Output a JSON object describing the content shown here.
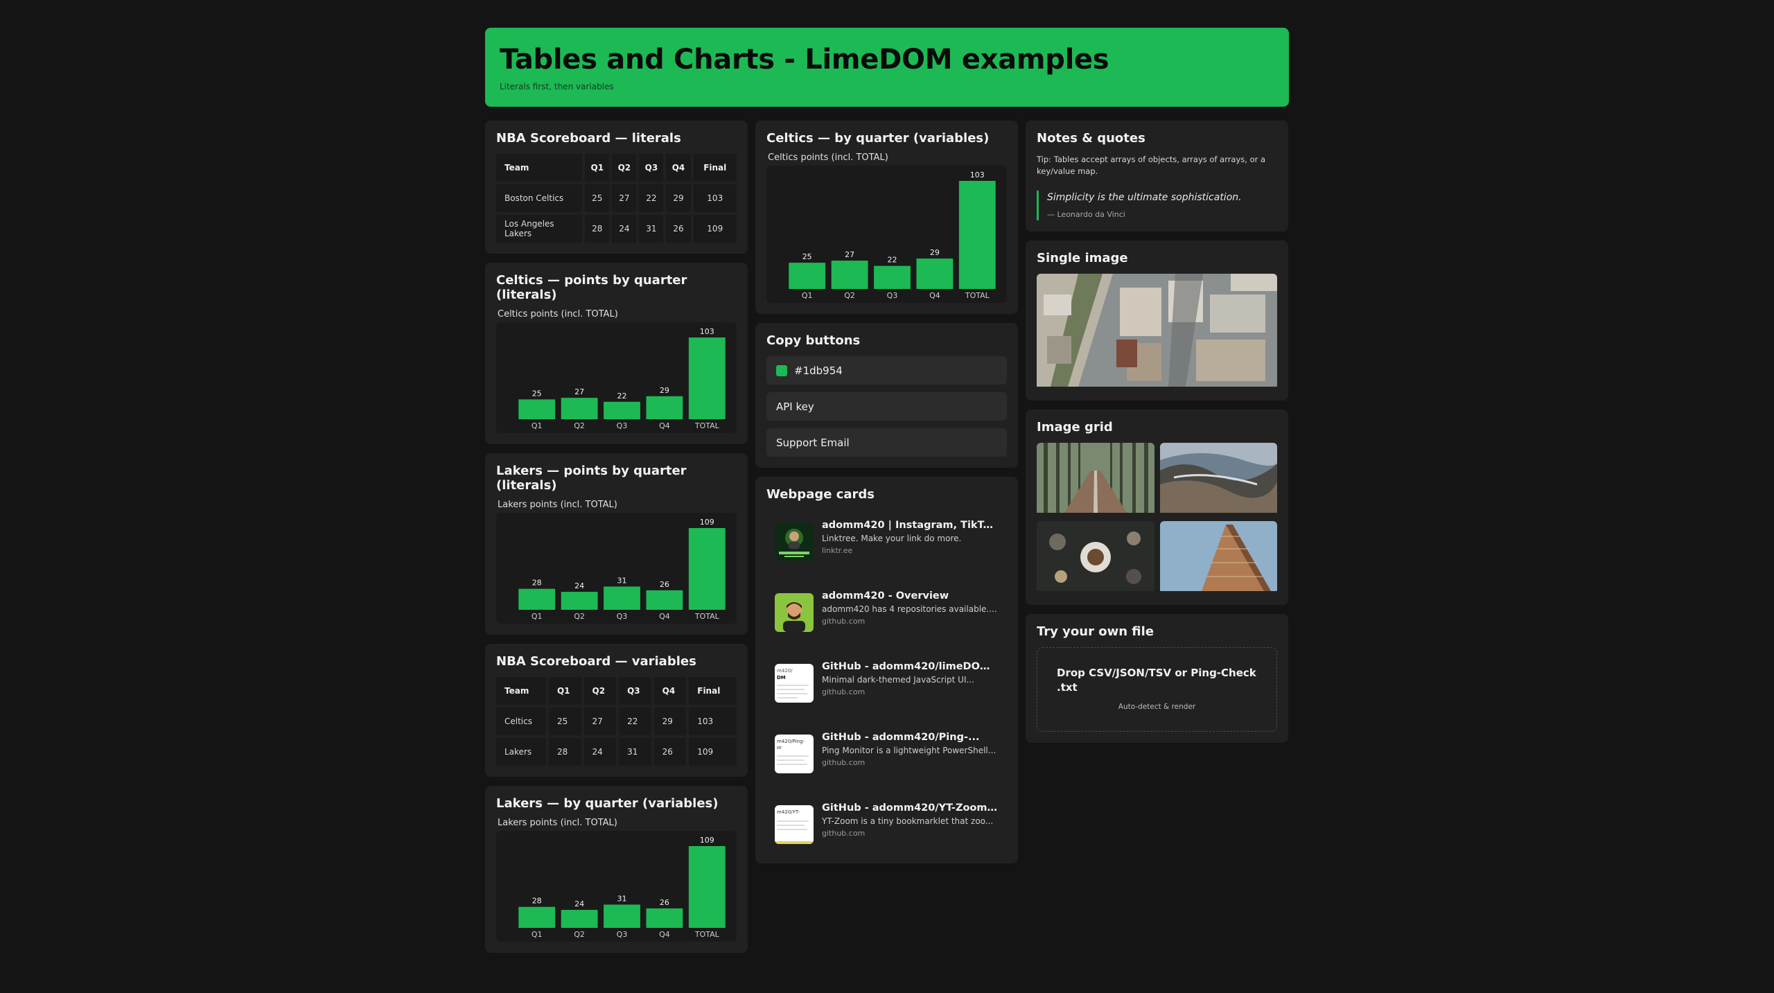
{
  "header": {
    "title": "Tables and Charts - LimeDOM examples",
    "subtitle": "Literals first, then variables"
  },
  "scoreboard_literals": {
    "title": "NBA Scoreboard — literals",
    "columns": [
      "Team",
      "Q1",
      "Q2",
      "Q3",
      "Q4",
      "Final"
    ],
    "rows": [
      [
        "Boston Celtics",
        "25",
        "27",
        "22",
        "29",
        "103"
      ],
      [
        "Los Angeles Lakers",
        "28",
        "24",
        "31",
        "26",
        "109"
      ]
    ]
  },
  "scoreboard_variables": {
    "title": "NBA Scoreboard — variables",
    "columns": [
      "Team",
      "Q1",
      "Q2",
      "Q3",
      "Q4",
      "Final"
    ],
    "rows": [
      [
        "Celtics",
        "25",
        "27",
        "22",
        "29",
        "103"
      ],
      [
        "Lakers",
        "28",
        "24",
        "31",
        "26",
        "109"
      ]
    ]
  },
  "cards": {
    "celtics_literals": "Celtics — points by quarter (literals)",
    "lakers_literals": "Lakers — points by quarter (literals)",
    "lakers_variables": "Lakers — by quarter (variables)",
    "celtics_variables": "Celtics — by quarter (variables)"
  },
  "chart_data": [
    {
      "type": "bar",
      "title": "Celtics points (incl. TOTAL)",
      "categories": [
        "Q1",
        "Q2",
        "Q3",
        "Q4",
        "TOTAL"
      ],
      "values": [
        25,
        27,
        22,
        29,
        103
      ],
      "data_labels": true,
      "grid": false
    },
    {
      "type": "bar",
      "title": "Lakers points (incl. TOTAL)",
      "categories": [
        "Q1",
        "Q2",
        "Q3",
        "Q4",
        "TOTAL"
      ],
      "values": [
        28,
        24,
        31,
        26,
        109
      ],
      "data_labels": true,
      "grid": false
    },
    {
      "type": "bar",
      "title": "Lakers points (incl. TOTAL)",
      "categories": [
        "Q1",
        "Q2",
        "Q3",
        "Q4",
        "TOTAL"
      ],
      "values": [
        28,
        24,
        31,
        26,
        109
      ],
      "data_labels": true,
      "grid": false
    },
    {
      "type": "bar",
      "title": "Celtics points (incl. TOTAL)",
      "categories": [
        "Q1",
        "Q2",
        "Q3",
        "Q4",
        "TOTAL"
      ],
      "values": [
        25,
        27,
        22,
        29,
        103
      ],
      "data_labels": true,
      "grid": false
    }
  ],
  "copy_buttons": {
    "title": "Copy buttons",
    "color_label": "#1db954",
    "api_label": "API key",
    "email_label": "Support Email"
  },
  "webpage_cards": {
    "title": "Webpage cards",
    "items": [
      {
        "title": "adomm420 | Instagram, TikTok,...",
        "desc": "Linktree. Make your link do more.",
        "url": "linktr.ee",
        "thumb": "linktree-avatar"
      },
      {
        "title": "adomm420 - Overview",
        "desc": "adomm420 has 4 repositories available....",
        "url": "github.com",
        "thumb": "github-avatar"
      },
      {
        "title": "GitHub - adomm420/limeDOM:...",
        "desc": "Minimal dark-themed JavaScript UI...",
        "url": "github.com",
        "thumb": "repo-preview",
        "thumb_text": "m420/\nDM"
      },
      {
        "title": "GitHub - adomm420/Ping-...",
        "desc": "Ping Monitor is a lightweight PowerShell...",
        "url": "github.com",
        "thumb": "repo-preview",
        "thumb_text": "m420/Ping-\nor"
      },
      {
        "title": "GitHub - adomm420/YT-Zoom:...",
        "desc": "YT-Zoom is a tiny bookmarklet that zoo...",
        "url": "github.com",
        "thumb": "repo-preview",
        "thumb_text": "m420/YT-"
      }
    ]
  },
  "notes": {
    "title": "Notes & quotes",
    "tip": "Tip: Tables accept arrays of objects, arrays of arrays, or a key/value map.",
    "quote": "Simplicity is the ultimate sophistication.",
    "author": "— Leonardo da Vinci"
  },
  "single_image": {
    "title": "Single image",
    "subject": "aerial city rooftops"
  },
  "image_grid": {
    "title": "Image grid",
    "subjects": [
      "forest road",
      "aerial coastline",
      "food plates",
      "flatiron building"
    ]
  },
  "try_file": {
    "title": "Try your own file",
    "drop_text": "Drop CSV/JSON/TSV or Ping-Check .txt",
    "hint": "Auto-detect & render"
  },
  "colors": {
    "accent": "#1db954",
    "background": "#141414",
    "card": "#212121"
  }
}
